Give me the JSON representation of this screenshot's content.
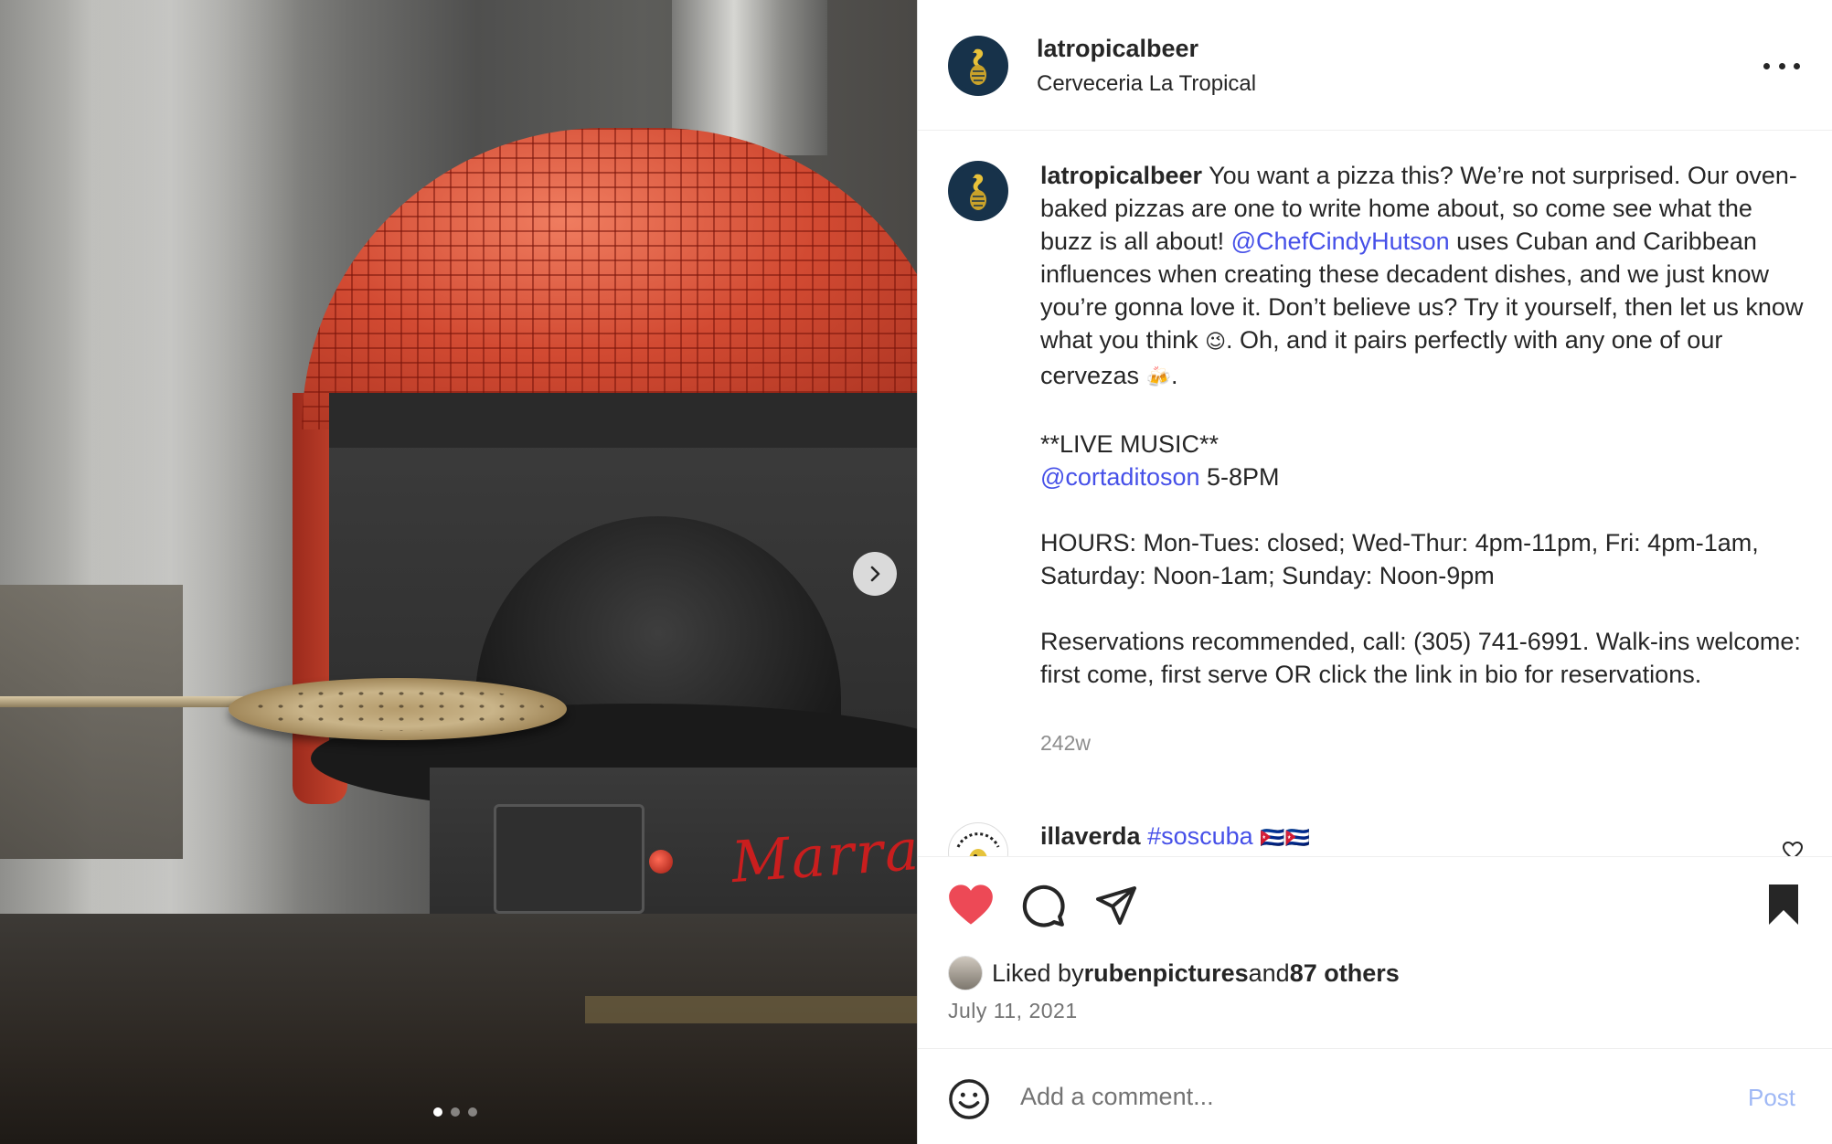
{
  "header": {
    "username": "latropicalbeer",
    "subtitle": "Cerveceria La Tropical"
  },
  "caption": {
    "username": "latropicalbeer",
    "text_1": " You want a pizza this? We’re not surprised. Our oven-baked pizzas are one to write home about, so come see what the buzz is all about! ",
    "mention_1": "@ChefCindyHutson",
    "text_2": " uses Cuban and Caribbean influences when creating these decadent dishes, and we just know you’re gonna love it. Don’t believe us? Try it yourself, then let us know what you think ",
    "emoji_1": "😉",
    "text_3": ". Oh, and it pairs perfectly with any one of our cervezas ",
    "emoji_2": "🍻",
    "text_4": ".",
    "live_music": "**LIVE MUSIC**",
    "mention_2": "@cortaditoson",
    "music_time": " 5-8PM",
    "hours": "HOURS: Mon-Tues: closed; Wed-Thur: 4pm-11pm, Fri: 4pm-1am, Saturday: Noon-1am; Sunday: Noon-9pm",
    "reservations": "Reservations recommended, call: (305) 741-6991. Walk-ins welcome: first come, first serve OR click the link in bio for reservations.",
    "time_ago": "242w"
  },
  "comment": {
    "username": "illaverda",
    "hashtag": "#soscuba",
    "emoji": "🇨🇺🇨🇺"
  },
  "likes": {
    "prefix": "Liked by ",
    "user": "rubenpictures",
    "middle": " and ",
    "others": "87 others"
  },
  "post_date": "July 11, 2021",
  "comment_input": {
    "placeholder": "Add a comment..."
  },
  "post_button": "Post",
  "carousel": {
    "dots": 3,
    "active_index": 0
  },
  "colors": {
    "mention": "#4650e8",
    "like_red": "#ed4956",
    "post_button_disabled": "#9fb8f5",
    "avatar_bg": "#17324a"
  },
  "icons": [
    "more-icon",
    "chevron-right-icon",
    "heart-icon",
    "comment-icon",
    "share-icon",
    "bookmark-icon",
    "smiley-icon",
    "heart-outline-icon"
  ]
}
